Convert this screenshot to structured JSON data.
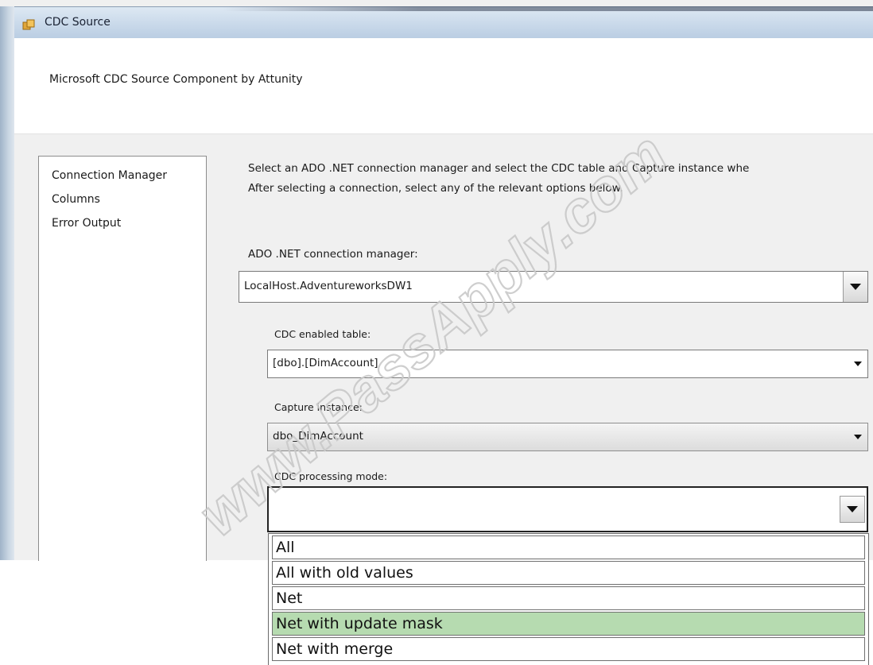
{
  "window": {
    "title": "CDC Source",
    "subtitle": "Microsoft CDC Source Component by Attunity"
  },
  "nav": {
    "items": [
      {
        "label": "Connection Manager"
      },
      {
        "label": "Columns"
      },
      {
        "label": "Error Output"
      }
    ]
  },
  "instructions": {
    "line1": "Select an ADO .NET connection manager and select the CDC table and Capture instance whe",
    "line2": "After selecting a connection, select any of the relevant options below."
  },
  "fields": {
    "connection_manager": {
      "label": "ADO .NET connection manager:",
      "value": "LocalHost.AdventureworksDW1"
    },
    "cdc_table": {
      "label": "CDC enabled table:",
      "value": "[dbo].[DimAccount]"
    },
    "capture_instance": {
      "label": "Capture instance:",
      "value": "dbo_DimAccount"
    },
    "processing_mode": {
      "label": "CDC processing mode:",
      "value": ""
    }
  },
  "processing_mode_options": [
    {
      "label": "All"
    },
    {
      "label": "All with old values"
    },
    {
      "label": "Net"
    },
    {
      "label": "Net with update mask",
      "selected": true
    },
    {
      "label": "Net with merge"
    }
  ],
  "watermark": {
    "text": "www.PassApply.com"
  },
  "colors": {
    "selected_item": "#b6dbb0",
    "title_bar": "#c9d9ea"
  },
  "icons": {
    "window_icon": "cdc-source-icon",
    "dropdown": "chevron-down-icon"
  }
}
